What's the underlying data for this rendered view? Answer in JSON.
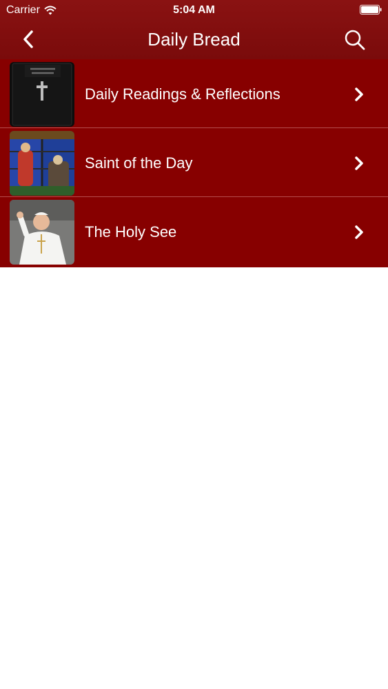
{
  "status_bar": {
    "carrier": "Carrier",
    "time": "5:04 AM",
    "icons": [
      "wifi-icon",
      "battery-icon"
    ]
  },
  "nav": {
    "title": "Daily Bread",
    "back_icon": "chevron-left-icon",
    "search_icon": "search-icon"
  },
  "menu": {
    "items": [
      {
        "label": "Daily Readings & Reflections",
        "thumbnail": "holy-bible-cover",
        "icon": "chevron-right-icon"
      },
      {
        "label": "Saint of the Day",
        "thumbnail": "stained-glass-window",
        "icon": "chevron-right-icon"
      },
      {
        "label": "The Holy See",
        "thumbnail": "pope-waving",
        "icon": "chevron-right-icon"
      }
    ]
  },
  "colors": {
    "nav_background": "#7f0f0f",
    "row_background": "#870000",
    "row_separator": "#b54d4d",
    "text": "#ffffff",
    "page_background": "#ffffff"
  }
}
